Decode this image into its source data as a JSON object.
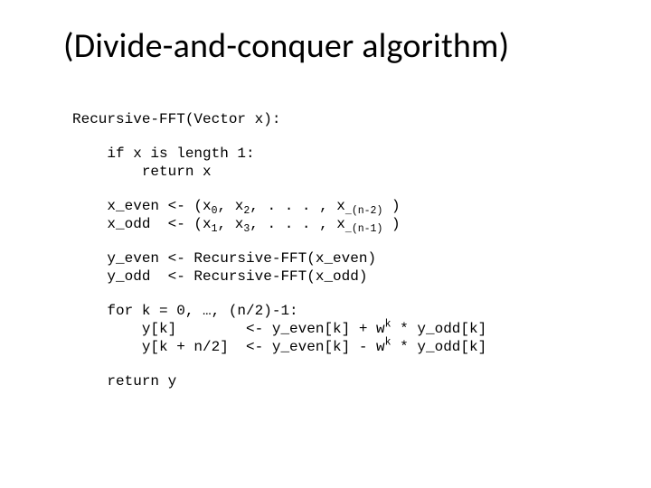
{
  "title": "(Divide-and-conquer algorithm)",
  "code": {
    "sig": "Recursive-FFT(Vector x):",
    "base1": "    if x is length 1:",
    "base2": "        return x",
    "even_pre": "    x_even <- (x",
    "even_s1": "0",
    "even_mid1": ", x",
    "even_s2": "2",
    "even_mid2": ", . . . , x",
    "even_s3": "_(n-2)",
    "even_post": " )",
    "odd_pre": "    x_odd  <- (x",
    "odd_s1": "1",
    "odd_mid1": ", x",
    "odd_s2": "3",
    "odd_mid2": ", . . . , x",
    "odd_s3": "_(n-1)",
    "odd_post": " )",
    "rec1": "    y_even <- Recursive-FFT(x_even)",
    "rec2": "    y_odd  <- Recursive-FFT(x_odd)",
    "loop1": "    for k = 0, …, (n/2)-1:",
    "loop2_pre": "        y[k]        <- y_even[k] + w",
    "loop2_sup": "k",
    "loop2_post": " * y_odd[k]",
    "loop3_pre": "        y[k + n/2]  <- y_even[k] - w",
    "loop3_sup": "k",
    "loop3_post": " * y_odd[k]",
    "ret": "    return y"
  }
}
